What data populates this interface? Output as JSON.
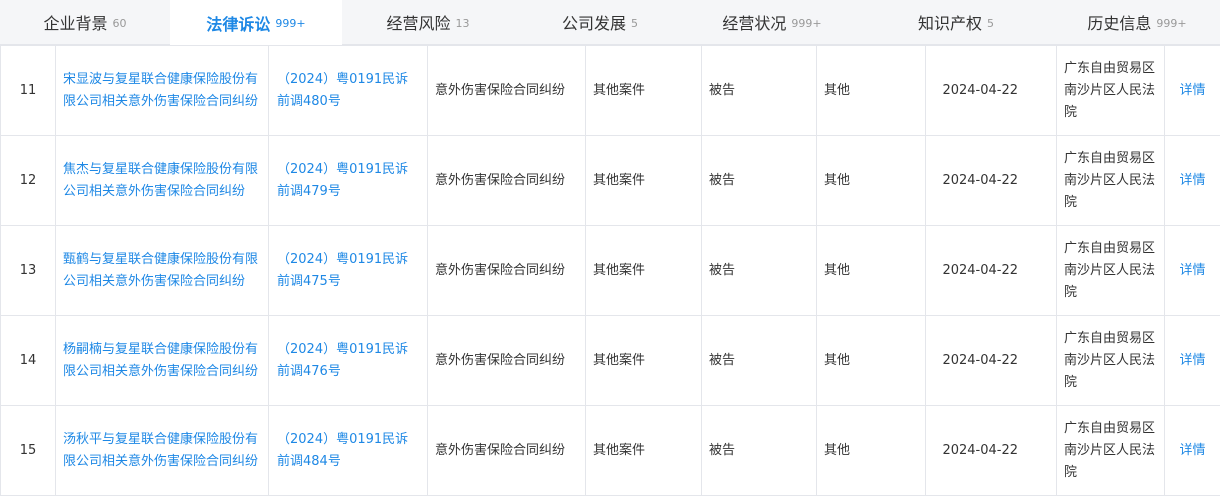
{
  "tabs": [
    {
      "label": "企业背景",
      "count": "60",
      "active": false
    },
    {
      "label": "法律诉讼",
      "count": "999+",
      "active": true
    },
    {
      "label": "经营风险",
      "count": "13",
      "active": false
    },
    {
      "label": "公司发展",
      "count": "5",
      "active": false
    },
    {
      "label": "经营状况",
      "count": "999+",
      "active": false
    },
    {
      "label": "知识产权",
      "count": "5",
      "active": false
    },
    {
      "label": "历史信息",
      "count": "999+",
      "active": false
    }
  ],
  "rows": [
    {
      "index": "11",
      "title": "宋显波与复星联合健康保险股份有限公司相关意外伤害保险合同纠纷",
      "case_no": "（2024）粤0191民诉前调480号",
      "cause": "意外伤害保险合同纠纷",
      "case_type": "其他案件",
      "role": "被告",
      "result": "其他",
      "date": "2024-04-22",
      "court": "广东自由贸易区南沙片区人民法院",
      "detail": "详情"
    },
    {
      "index": "12",
      "title": "焦杰与复星联合健康保险股份有限公司相关意外伤害保险合同纠纷",
      "case_no": "（2024）粤0191民诉前调479号",
      "cause": "意外伤害保险合同纠纷",
      "case_type": "其他案件",
      "role": "被告",
      "result": "其他",
      "date": "2024-04-22",
      "court": "广东自由贸易区南沙片区人民法院",
      "detail": "详情"
    },
    {
      "index": "13",
      "title": "甄鹤与复星联合健康保险股份有限公司相关意外伤害保险合同纠纷",
      "case_no": "（2024）粤0191民诉前调475号",
      "cause": "意外伤害保险合同纠纷",
      "case_type": "其他案件",
      "role": "被告",
      "result": "其他",
      "date": "2024-04-22",
      "court": "广东自由贸易区南沙片区人民法院",
      "detail": "详情"
    },
    {
      "index": "14",
      "title": "杨嗣楠与复星联合健康保险股份有限公司相关意外伤害保险合同纠纷",
      "case_no": "（2024）粤0191民诉前调476号",
      "cause": "意外伤害保险合同纠纷",
      "case_type": "其他案件",
      "role": "被告",
      "result": "其他",
      "date": "2024-04-22",
      "court": "广东自由贸易区南沙片区人民法院",
      "detail": "详情"
    },
    {
      "index": "15",
      "title": "汤秋平与复星联合健康保险股份有限公司相关意外伤害保险合同纠纷",
      "case_no": "（2024）粤0191民诉前调484号",
      "cause": "意外伤害保险合同纠纷",
      "case_type": "其他案件",
      "role": "被告",
      "result": "其他",
      "date": "2024-04-22",
      "court": "广东自由贸易区南沙片区人民法院",
      "detail": "详情"
    }
  ]
}
